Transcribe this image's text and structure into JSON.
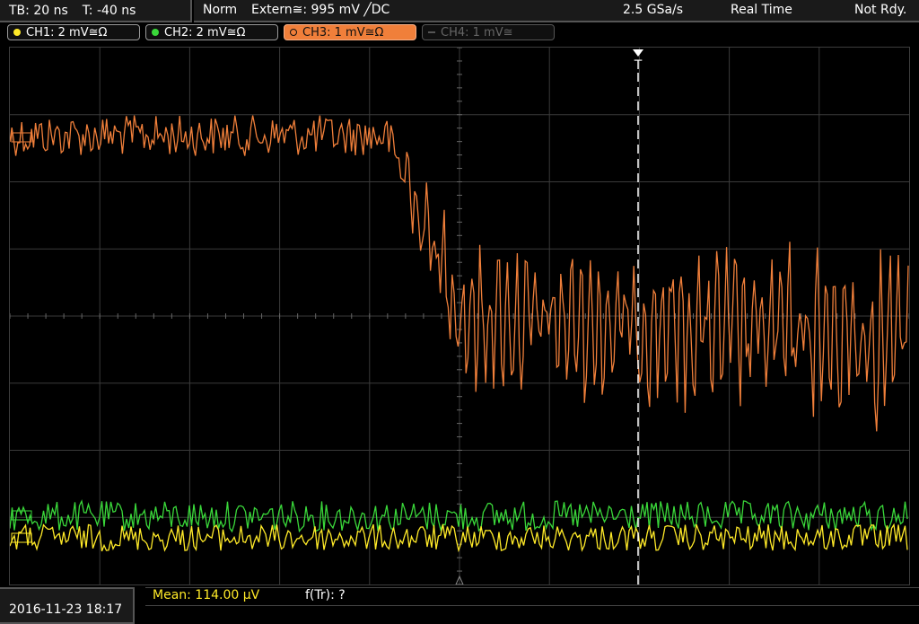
{
  "status": {
    "timebase": "TB: 20 ns",
    "trigger_time": "T: -40 ns",
    "mode": "Norm",
    "trigger_source": "Extern≅: 995 mV ╱DC",
    "sample_rate": "2.5 GSa/s",
    "acq_mode": "Real Time",
    "state": "Not Rdy."
  },
  "channels": [
    {
      "label": "CH1: 2 mV≅Ω",
      "color": "#ffea28",
      "active": true
    },
    {
      "label": "CH2: 2 mV≅Ω",
      "color": "#3ad83a",
      "active": true
    },
    {
      "label": "CH3: 1 mV≅Ω",
      "color": "#f07f3a",
      "active": true
    },
    {
      "label": "CH4: 1 mV≅",
      "color": "#666666",
      "active": false
    }
  ],
  "trigger_marker": "T",
  "footer": {
    "datetime": "2016-11-23 18:17",
    "measurement_1": "Mean: 114.00 µV",
    "measurement_2": "f(Tr): ?"
  },
  "colors": {
    "grid": "#3a3a3a",
    "ch1": "#ffea28",
    "ch2": "#3ad83a",
    "ch3": "#f07f3a"
  }
}
